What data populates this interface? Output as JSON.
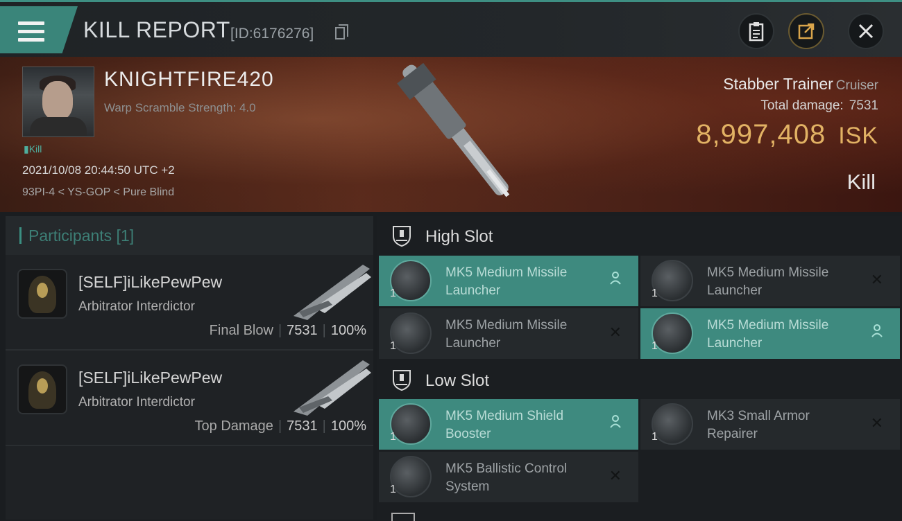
{
  "titlebar": {
    "title": "KILL REPORT",
    "id_label": "[ID:6176276]",
    "menu_icon": "hamburger-icon",
    "actions": [
      "clipboard-icon",
      "share-icon",
      "close-icon"
    ]
  },
  "victim": {
    "name": "KNIGHTFIRE420",
    "warp_scramble": "Warp Scramble Strength: 4.0",
    "tag": "Kill",
    "datetime": "2021/10/08 20:44:50 UTC +2",
    "location": "93PI-4 < YS-GOP < Pure Blind",
    "ship_name": "Stabber Trainer",
    "ship_class": "Cruiser",
    "total_damage_label": "Total damage:",
    "total_damage": "7531",
    "isk_value": "8,997,408",
    "isk_unit": "ISK",
    "result": "Kill"
  },
  "participants": {
    "header": "Participants [1]",
    "rows": [
      {
        "name": "[SELF]iLikePewPew",
        "ship": "Arbitrator Interdictor",
        "role": "Final Blow",
        "damage": "7531",
        "percent": "100%"
      },
      {
        "name": "[SELF]iLikePewPew",
        "ship": "Arbitrator Interdictor",
        "role": "Top Damage",
        "damage": "7531",
        "percent": "100%"
      }
    ]
  },
  "fitting": {
    "high_slot": {
      "label": "High Slot",
      "modules": [
        {
          "name": "MK5 Medium Missile Launcher",
          "qty": "1",
          "status": "dropped",
          "status_icon": "person-icon"
        },
        {
          "name": "MK5 Medium Missile Launcher",
          "qty": "1",
          "status": "destroyed",
          "status_icon": "x-icon"
        },
        {
          "name": "MK5 Medium Missile Launcher",
          "qty": "1",
          "status": "destroyed",
          "status_icon": "x-icon"
        },
        {
          "name": "MK5 Medium Missile Launcher",
          "qty": "1",
          "status": "dropped",
          "status_icon": "person-icon"
        }
      ]
    },
    "low_slot": {
      "label": "Low Slot",
      "modules": [
        {
          "name": "MK5 Medium Shield Booster",
          "qty": "1",
          "status": "dropped",
          "status_icon": "person-icon"
        },
        {
          "name": "MK3 Small Armor Repairer",
          "qty": "1",
          "status": "destroyed",
          "status_icon": "x-icon"
        },
        {
          "name": "MK5 Ballistic Control System",
          "qty": "1",
          "status": "destroyed",
          "status_icon": "x-icon"
        }
      ]
    }
  },
  "colors": {
    "accent": "#3e8a7f",
    "isk": "#e2b264",
    "banner": "#4a2117"
  }
}
